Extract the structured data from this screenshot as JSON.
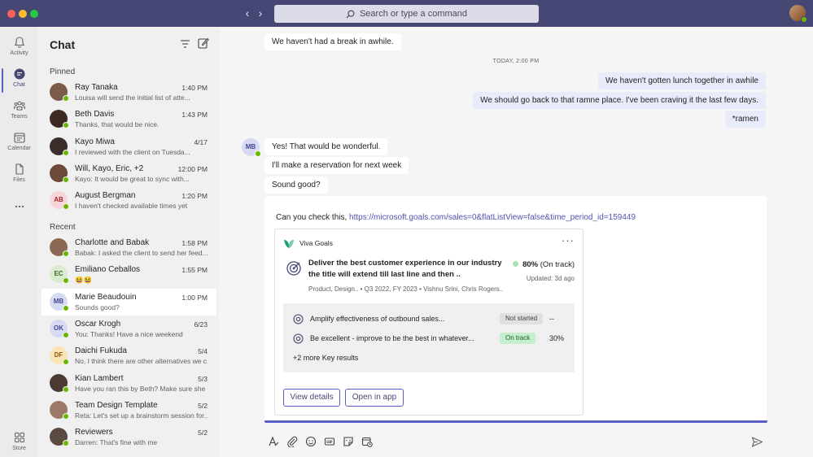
{
  "titlebar": {
    "search_placeholder": "Search or type a command",
    "icons": [
      "back-arrow-icon",
      "forward-arrow-icon",
      "search-icon"
    ]
  },
  "rail": {
    "items": [
      {
        "label": "Activity",
        "icon": "bell-icon"
      },
      {
        "label": "Chat",
        "icon": "chat-icon",
        "active": true
      },
      {
        "label": "Teams",
        "icon": "teams-icon"
      },
      {
        "label": "Calendar",
        "icon": "calendar-icon"
      },
      {
        "label": "Files",
        "icon": "file-icon"
      },
      {
        "label": "",
        "icon": "more-icon"
      },
      {
        "label": "Store",
        "icon": "store-icon"
      }
    ]
  },
  "chatlist": {
    "title": "Chat",
    "pinned_label": "Pinned",
    "recent_label": "Recent",
    "pinned": [
      {
        "name": "Ray Tanaka",
        "time": "1:40 PM",
        "preview": "Louisa will send the initial list of atte...",
        "avatar_color": "#7a5a48"
      },
      {
        "name": "Beth Davis",
        "time": "1:43 PM",
        "preview": "Thanks, that would be nice.",
        "avatar_color": "#3e2a22"
      },
      {
        "name": "Kayo Miwa",
        "time": "4/17",
        "preview": "I reviewed with the client on Tuesda...",
        "avatar_color": "#3a2e2a"
      },
      {
        "name": "Will, Kayo, Eric, +2",
        "time": "12:00 PM",
        "preview": "Kayo: It would be great to sync with...",
        "avatar_color": "#6b4a3a"
      },
      {
        "name": "August Bergman",
        "time": "1:20 PM",
        "preview": "I haven't checked available times yet",
        "initials": "AB",
        "avatar_color": "#f8d5d8",
        "initials_color": "#a4262c"
      }
    ],
    "recent": [
      {
        "name": "Charlotte and Babak",
        "time": "1:58 PM",
        "preview": "Babak: I asked the client to send her feed...",
        "avatar_color": "#8a6a55"
      },
      {
        "name": "Emiliano Ceballos",
        "time": "1:55 PM",
        "preview": "😆😆",
        "initials": "EC",
        "avatar_color": "#d9ecd0",
        "initials_color": "#3b6b1f"
      },
      {
        "name": "Marie Beaudouin",
        "time": "1:00 PM",
        "preview": "Sounds good?",
        "initials": "MB",
        "avatar_color": "#d6dbf3",
        "initials_color": "#444791",
        "selected": true
      },
      {
        "name": "Oscar Krogh",
        "time": "6/23",
        "preview": "You: Thanks! Have a nice weekend",
        "initials": "OK",
        "avatar_color": "#d6dbf3",
        "initials_color": "#444791"
      },
      {
        "name": "Daichi Fukuda",
        "time": "5/4",
        "preview": "No, I think there are other alternatives we c...",
        "initials": "DF",
        "avatar_color": "#fbe3b8",
        "initials_color": "#8a5a00"
      },
      {
        "name": "Kian Lambert",
        "time": "5/3",
        "preview": "Have you ran this by Beth? Make sure she is...",
        "avatar_color": "#4a3a32"
      },
      {
        "name": "Team Design Template",
        "time": "5/2",
        "preview": "Reta: Let's set up a brainstorm session for...",
        "avatar_color": "#9a7a66"
      },
      {
        "name": "Reviewers",
        "time": "5/2",
        "preview": "Darren: That's fine with me",
        "avatar_color": "#5a4a40"
      }
    ]
  },
  "conversation": {
    "first_in": "We haven't had a break in awhile.",
    "day_separator": "TODAY, 2:00 PM",
    "out_messages": [
      "We haven't gotten lunch together in awhile",
      "We should go back to that ramne place. I've been craving it the last few days.",
      "*ramen"
    ],
    "sender_initials": "MB",
    "in_messages": [
      "Yes! That would be wonderful.",
      "I'll make a reservation for next week",
      "Sound good?"
    ],
    "card_message": {
      "lead_text": "Can you check this,",
      "link": "https://microsoft.goals.com/sales=0&flatListView=false&time_period_id=159449"
    }
  },
  "card": {
    "app_name": "Viva Goals",
    "more_label": "···",
    "objective_title": "Deliver the best customer experience in our industry the title will extend till last line and then ..",
    "objective_meta": "Product, Design.. • Q3 2022, FY 2023 • Vishnu Srini, Chris Rogers..",
    "progress_value": "80%",
    "progress_status": "(On track)",
    "updated": "Updated: 3d ago",
    "key_results": [
      {
        "text": "Amplify effectiveness of outbound sales...",
        "status": "Not started",
        "value": "--",
        "status_kind": "notstarted"
      },
      {
        "text": "Be excellent - improve to be the best in whatever...",
        "status": "On track",
        "value": "30%",
        "status_kind": "ontrack"
      }
    ],
    "more_results": "+2 more Key results",
    "view_details": "View details",
    "open_in_app": "Open in app",
    "colors": {
      "accent": "#5b5fc7",
      "on_track": "#c6efce",
      "progress_dot": "#a6e3b5"
    }
  },
  "compose": {
    "tools": [
      "format-icon",
      "attach-icon",
      "emoji-icon",
      "gif-icon",
      "sticker-icon",
      "schedule-meeting-icon"
    ],
    "send_icon": "send-icon"
  },
  "colors": {
    "titlebar": "#464775",
    "brand": "#5b5fc7",
    "presence_available": "#6bb700"
  }
}
